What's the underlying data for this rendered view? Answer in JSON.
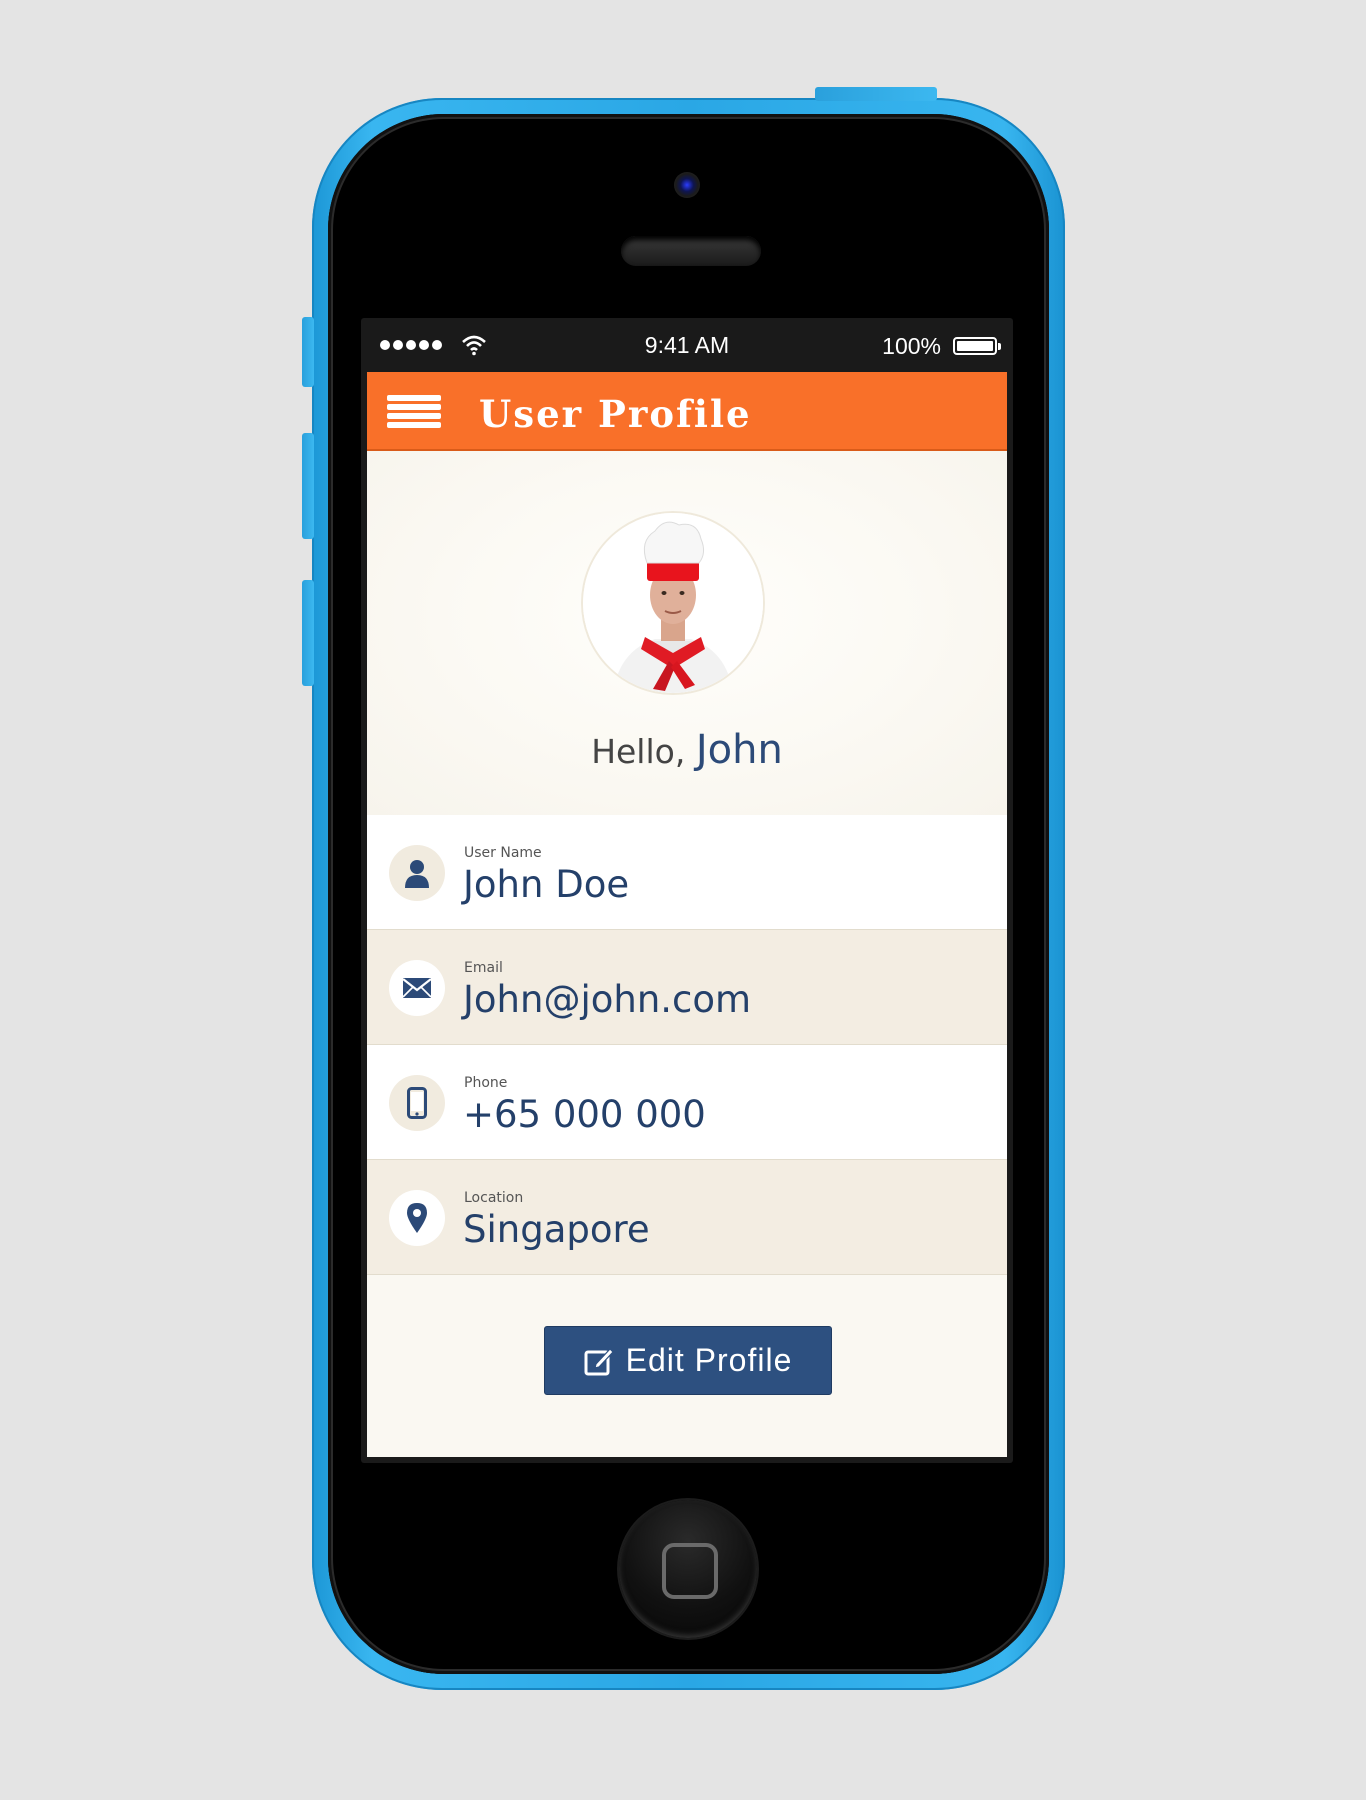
{
  "status_bar": {
    "signal_icon": "signal-dots-icon",
    "wifi_icon": "wifi-icon",
    "time": "9:41 AM",
    "battery_percent": "100%",
    "battery_level": 1.0
  },
  "app_bar": {
    "menu_icon": "hamburger-menu-icon",
    "title": "User Profile",
    "color": "#f97029"
  },
  "profile": {
    "avatar": "chef-avatar",
    "greeting_prefix": "Hello,",
    "greeting_name": "John"
  },
  "fields": [
    {
      "icon": "user-icon",
      "label": "User Name",
      "value": "John Doe"
    },
    {
      "icon": "envelope-icon",
      "label": "Email",
      "value": "John@john.com"
    },
    {
      "icon": "phone-icon",
      "label": "Phone",
      "value": "+65 000 000"
    },
    {
      "icon": "location-pin-icon",
      "label": "Location",
      "value": "Singapore"
    }
  ],
  "actions": {
    "edit_icon": "edit-icon",
    "edit_label": "Edit Profile",
    "button_color": "#2d5080"
  },
  "colors": {
    "accent": "#f97029",
    "text_primary": "#24406a",
    "phone_body": "#2aa7e5",
    "row_beige": "#f3ede2"
  }
}
